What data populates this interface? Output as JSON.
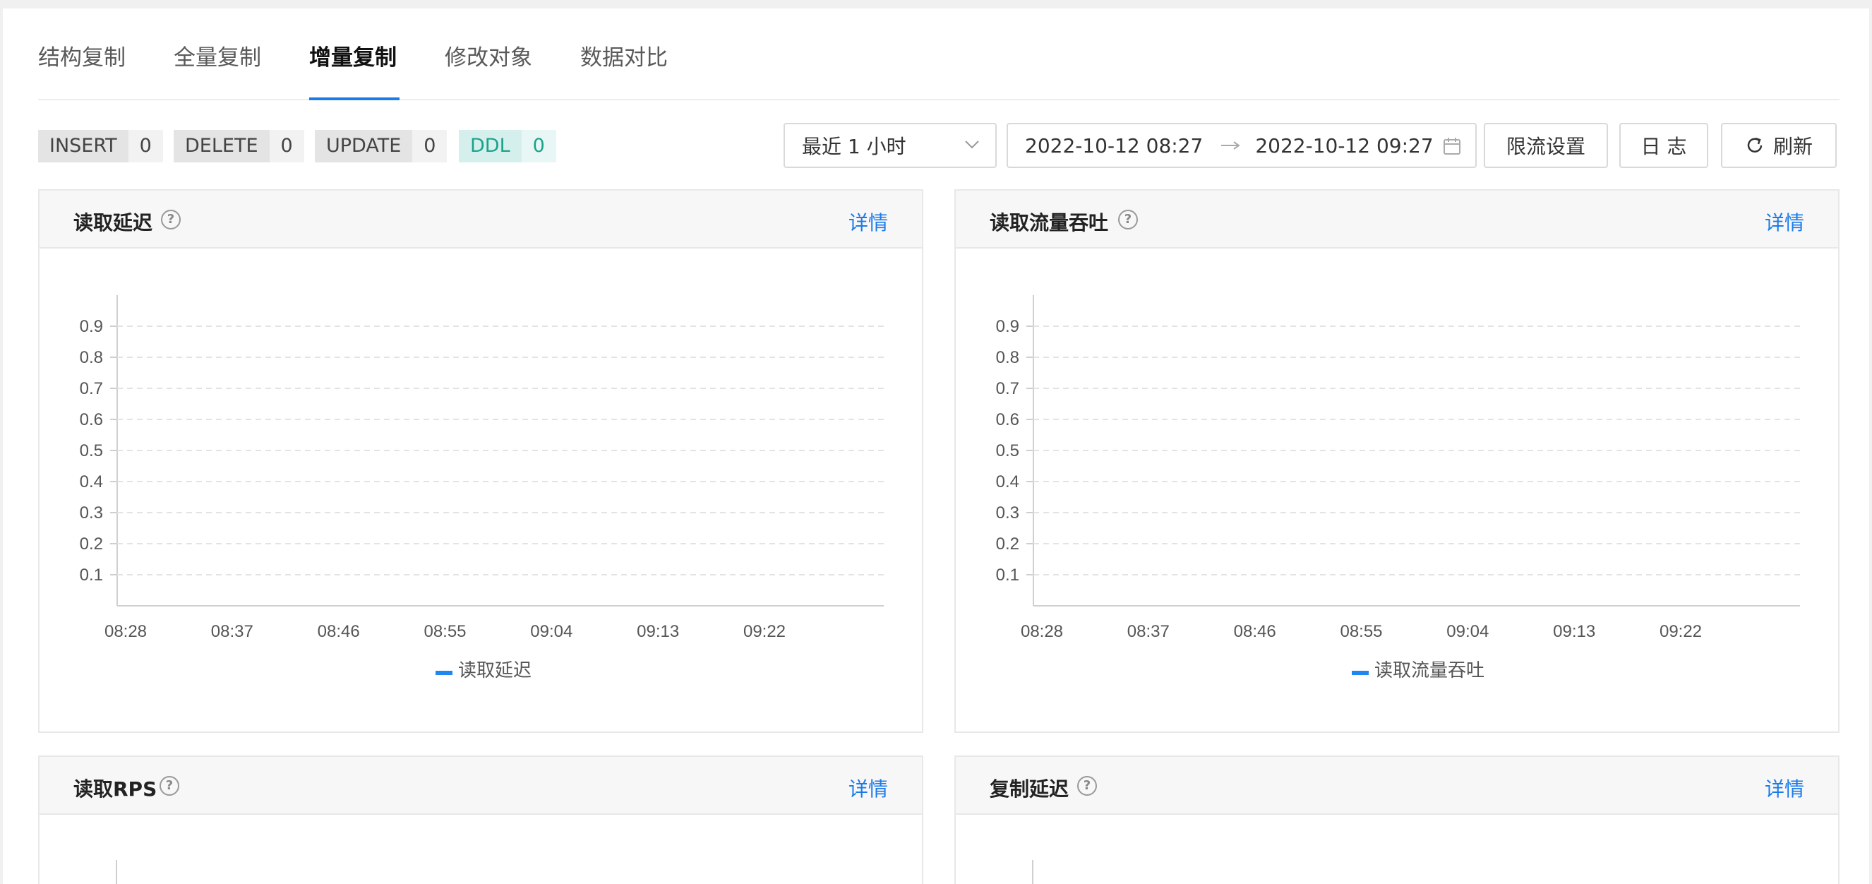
{
  "tabs": [
    {
      "label": "结构复制",
      "active": false
    },
    {
      "label": "全量复制",
      "active": false
    },
    {
      "label": "增量复制",
      "active": true
    },
    {
      "label": "修改对象",
      "active": false
    },
    {
      "label": "数据对比",
      "active": false
    }
  ],
  "stats": [
    {
      "name": "INSERT",
      "value": "0"
    },
    {
      "name": "DELETE",
      "value": "0"
    },
    {
      "name": "UPDATE",
      "value": "0"
    },
    {
      "name": "DDL",
      "value": "0"
    }
  ],
  "toolbar": {
    "range_select": "最近 1 小时",
    "start_time": "2022-10-12 08:27",
    "end_time": "2022-10-12 09:27",
    "rate_limit_label": "限流设置",
    "log_label": "日 志",
    "refresh_label": "刷新"
  },
  "colors": {
    "accent": "#1a7bea",
    "ddl": "#1aa38c",
    "series": "#1e88f0"
  },
  "panels": [
    {
      "title": "读取延迟",
      "detail": "详情",
      "legend": "读取延迟"
    },
    {
      "title": "读取流量吞吐",
      "detail": "详情",
      "legend": "读取流量吞吐"
    },
    {
      "title": "读取RPS",
      "detail": "详情"
    },
    {
      "title": "复制延迟",
      "detail": "详情"
    }
  ],
  "chart_data": [
    {
      "type": "line",
      "legend": "读取延迟",
      "x": [
        "08:28",
        "08:37",
        "08:46",
        "08:55",
        "09:04",
        "09:13",
        "09:22"
      ],
      "yticks": [
        "0.1",
        "0.2",
        "0.3",
        "0.4",
        "0.5",
        "0.6",
        "0.7",
        "0.8",
        "0.9"
      ],
      "ylim": [
        0,
        1
      ],
      "series": [
        {
          "name": "读取延迟",
          "values": []
        }
      ],
      "grid": true,
      "legend_position": "bottom"
    },
    {
      "type": "line",
      "legend": "读取流量吞吐",
      "x": [
        "08:28",
        "08:37",
        "08:46",
        "08:55",
        "09:04",
        "09:13",
        "09:22"
      ],
      "yticks": [
        "0.1",
        "0.2",
        "0.3",
        "0.4",
        "0.5",
        "0.6",
        "0.7",
        "0.8",
        "0.9"
      ],
      "ylim": [
        0,
        1
      ],
      "series": [
        {
          "name": "读取流量吞吐",
          "values": []
        }
      ],
      "grid": true,
      "legend_position": "bottom"
    }
  ]
}
